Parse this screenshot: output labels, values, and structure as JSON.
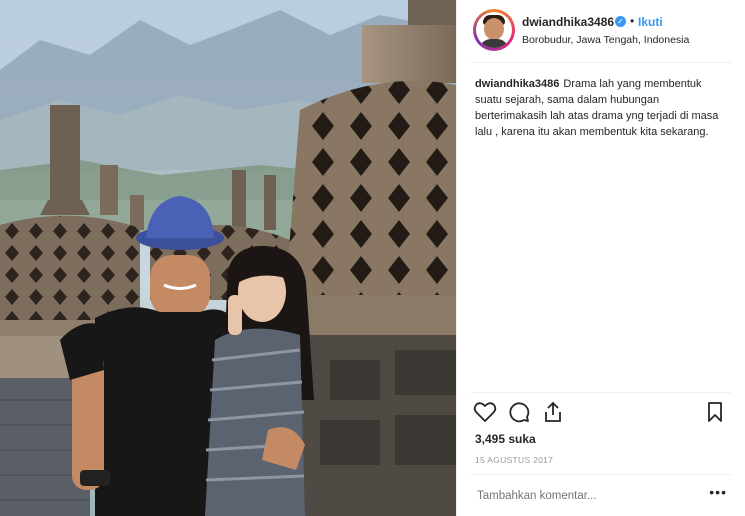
{
  "post": {
    "username": "dwiandhika3486",
    "verified_icon": "verified-badge-icon",
    "separator": "•",
    "follow_label": "Ikuti",
    "location": "Borobudur, Jawa Tengah, Indonesia",
    "caption_user": "dwiandhika3486",
    "caption_text": "Drama lah yang membentuk suatu sejarah, sama dalam hubungan berterimakasih lah atas drama yng terjadi di masa lalu , karena itu akan membentuk kita sekarang.",
    "likes": "3,495 suka",
    "date": "15 AGUSTUS 2017",
    "comment_placeholder": "Tambahkan komentar...",
    "more_label": "•••"
  },
  "icons": {
    "like": "heart-icon",
    "comment": "comment-bubble-icon",
    "share": "share-upload-icon",
    "save": "bookmark-icon"
  },
  "colors": {
    "link_blue": "#3897f0",
    "divider": "#efefef",
    "muted_text": "#999999"
  }
}
